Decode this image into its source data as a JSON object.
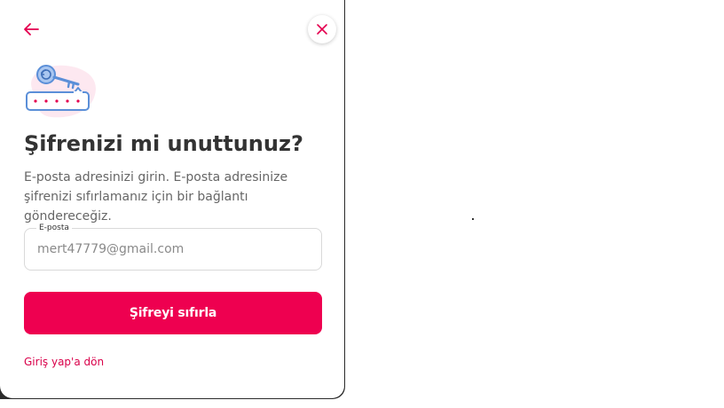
{
  "modal": {
    "title": "Şifrenizi mi unuttunuz?",
    "description": "E-posta adresinizi girin. E-posta adresinize şifrenizi sıfırlamanız için bir bağlantı göndereceğiz.",
    "email_field": {
      "label": "E-posta",
      "value": "mert47779@gmail.com"
    },
    "submit_label": "Şifreyi sıfırla",
    "login_link": "Giriş yap'a dön",
    "icons": {
      "back": "arrow-left-icon",
      "close": "close-icon",
      "illustration": "key-password-illustration"
    }
  },
  "colors": {
    "accent": "#ee0050",
    "link": "#d9004a",
    "title": "#333333",
    "text": "#666666",
    "illustration_blue": "#5b8fd8",
    "illustration_blob": "#fde8f0"
  }
}
